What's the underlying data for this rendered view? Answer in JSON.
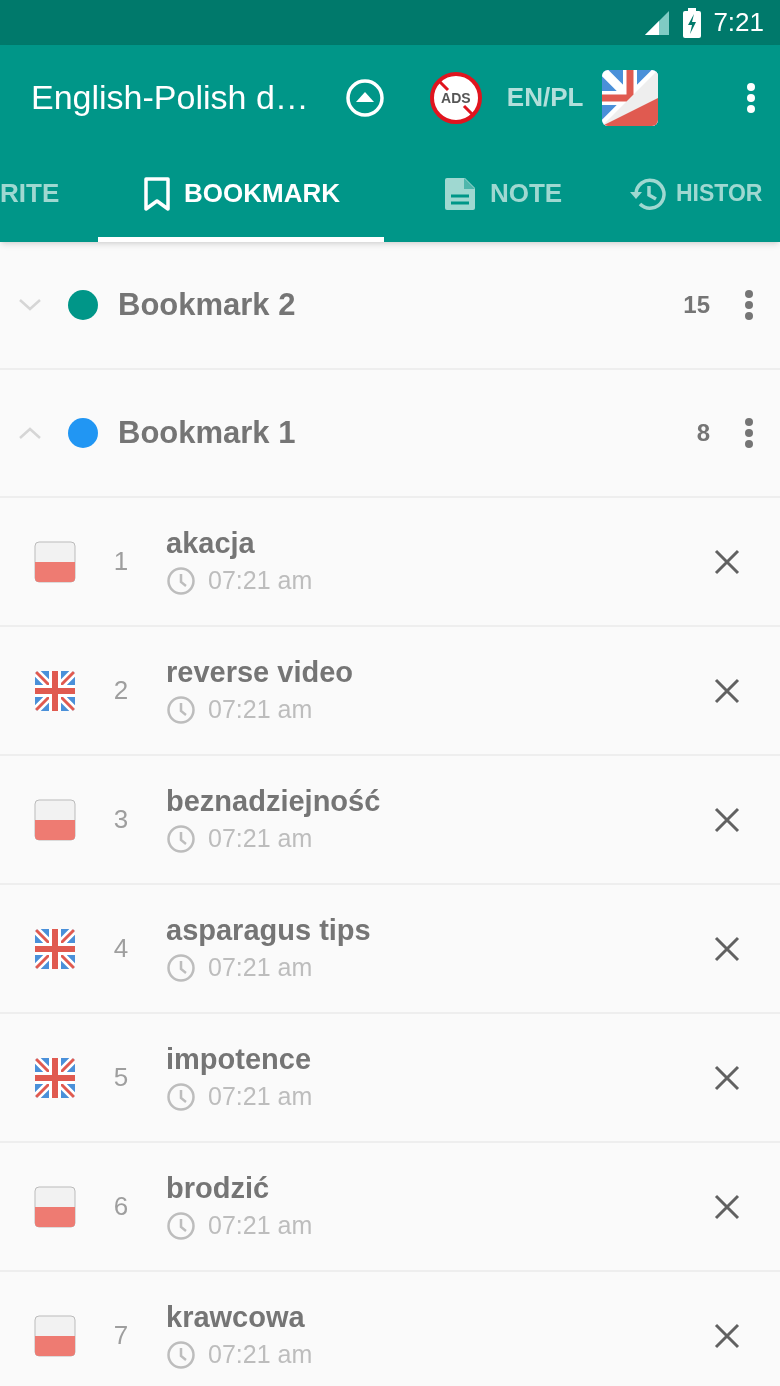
{
  "status_bar": {
    "time": "7:21"
  },
  "app_bar": {
    "title": "English-Polish d…",
    "ads_badge": "ADS",
    "language_pair": "EN/PL"
  },
  "tabs": [
    {
      "label": "RITE",
      "kind": "plain",
      "selected": false
    },
    {
      "label": "BOOKMARK",
      "kind": "bookmark",
      "selected": true
    },
    {
      "label": "NOTE",
      "kind": "note",
      "selected": false
    },
    {
      "label": "HISTOR",
      "kind": "history",
      "selected": false
    }
  ],
  "groups": [
    {
      "name": "Bookmark 2",
      "color": "#009688",
      "count": "15",
      "expanded": false
    },
    {
      "name": "Bookmark 1",
      "color": "#2196f3",
      "count": "8",
      "expanded": true,
      "entries": [
        {
          "index": "1",
          "word": "akacja",
          "time": "07:21 am",
          "kind": "pl"
        },
        {
          "index": "2",
          "word": "reverse video",
          "time": "07:21 am",
          "kind": "en"
        },
        {
          "index": "3",
          "word": "beznadziejność",
          "time": "07:21 am",
          "kind": "pl"
        },
        {
          "index": "4",
          "word": "asparagus tips",
          "time": "07:21 am",
          "kind": "en"
        },
        {
          "index": "5",
          "word": "impotence",
          "time": "07:21 am",
          "kind": "en"
        },
        {
          "index": "6",
          "word": "brodzić",
          "time": "07:21 am",
          "kind": "pl"
        },
        {
          "index": "7",
          "word": "krawcowa",
          "time": "07:21 am",
          "kind": "pl"
        }
      ]
    }
  ]
}
